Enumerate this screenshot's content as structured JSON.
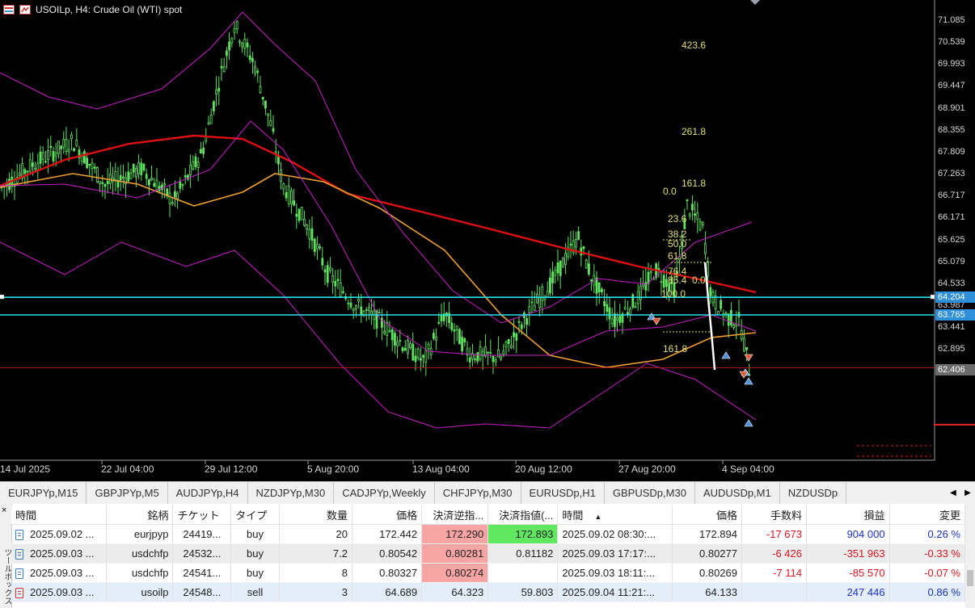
{
  "chart": {
    "title": "USOILp, H4:  Crude Oil (WTI) spot",
    "price_axis": [
      "71.085",
      "70.539",
      "69.993",
      "69.447",
      "68.901",
      "68.355",
      "67.809",
      "67.263",
      "66.717",
      "66.171",
      "65.625",
      "65.079",
      "64.533",
      "63.987",
      "63.441",
      "62.895"
    ],
    "price_badges": [
      {
        "label": "64.204",
        "price": 64.204,
        "color": "#2f8fd8"
      },
      {
        "label": "63.765",
        "price": 63.765,
        "color": "#2f8fd8"
      },
      {
        "label": "62.406",
        "price": 62.406,
        "color": "#6b6b6b"
      }
    ],
    "horizontal_lines": [
      {
        "price": 64.204,
        "color": "#27e0f0"
      },
      {
        "price": 63.765,
        "color": "#27e0f0"
      },
      {
        "price": 62.45,
        "color": "#b01818"
      }
    ],
    "time_axis": [
      "14 Jul 2025",
      "22 Jul 04:00",
      "29 Jul 12:00",
      "5 Aug 20:00",
      "13 Aug 04:00",
      "20 Aug 12:00",
      "27 Aug 20:00",
      "4 Sep 04:00"
    ],
    "fib_labels": [
      {
        "label": "423.6",
        "price": 70.48
      },
      {
        "label": "261.8",
        "price": 68.33
      },
      {
        "label": "161.8",
        "price": 67.04
      },
      {
        "label": "0.0",
        "price": 66.84
      },
      {
        "label": "23.6",
        "price": 66.15
      },
      {
        "label": "38.2",
        "price": 65.78
      },
      {
        "label": "50.0",
        "price": 65.53
      },
      {
        "label": "61.8",
        "price": 65.24
      },
      {
        "label": "76.4",
        "price": 64.85
      },
      {
        "label": "85.4",
        "price": 64.63
      },
      {
        "label": "0.0",
        "price": 64.63
      },
      {
        "label": "100.0",
        "price": 64.28
      },
      {
        "label": "161.8",
        "price": 62.93
      }
    ],
    "colors": {
      "candle": "#5fe35f",
      "bollinger": "#c81ec8",
      "ma_slow": "#e01010",
      "ma_fast": "#f0a030",
      "fib": "#e0e070",
      "level": "#27e0f0"
    }
  },
  "tabs": [
    "EURJPYp,M15",
    "GBPJPYp,M5",
    "AUDJPYp,H4",
    "NZDJPYp,M30",
    "CADJPYp,Weekly",
    "CHFJPYp,M30",
    "EURUSDp,H1",
    "GBPUSDp,M30",
    "AUDUSDp,M1",
    "NZDUSDp"
  ],
  "table": {
    "side_label": "ツールボックス",
    "columns": [
      "時間",
      "銘柄",
      "チケット",
      "タイプ",
      "数量",
      "価格",
      "決済逆指...",
      "決済指値(...",
      "時間",
      "価格",
      "手数料",
      "損益",
      "変更"
    ],
    "rows": [
      {
        "time": "2025.09.02 ...",
        "symbol": "eurjpyp",
        "ticket": "24419...",
        "type": "buy",
        "volume": "20",
        "price": "172.442",
        "sl": "172.290",
        "tp": "172.893",
        "close_time": "2025.09.02 08:30:...",
        "cur_price": "172.894",
        "commission": "-17 673",
        "profit": "904 000",
        "change": "0.26 %"
      },
      {
        "time": "2025.09.03 ...",
        "symbol": "usdchfp",
        "ticket": "24532...",
        "type": "buy",
        "volume": "7.2",
        "price": "0.80542",
        "sl": "0.80281",
        "tp": "0.81182",
        "close_time": "2025.09.03 17:17:...",
        "cur_price": "0.80277",
        "commission": "-6 426",
        "profit": "-351 963",
        "change": "-0.33 %"
      },
      {
        "time": "2025.09.03 ...",
        "symbol": "usdchfp",
        "ticket": "24541...",
        "type": "buy",
        "volume": "8",
        "price": "0.80327",
        "sl": "0.80274",
        "tp": "",
        "close_time": "2025.09.03 18:11:...",
        "cur_price": "0.80269",
        "commission": "-7 114",
        "profit": "-85 570",
        "change": "-0.07 %"
      },
      {
        "time": "2025.09.03 ...",
        "symbol": "usoilp",
        "ticket": "24548...",
        "type": "sell",
        "volume": "3",
        "price": "64.689",
        "sl": "64.323",
        "tp": "59.803",
        "close_time": "2025.09.04 11:21:...",
        "cur_price": "64.133",
        "commission": "",
        "profit": "247 446",
        "change": "0.86 %"
      }
    ]
  }
}
